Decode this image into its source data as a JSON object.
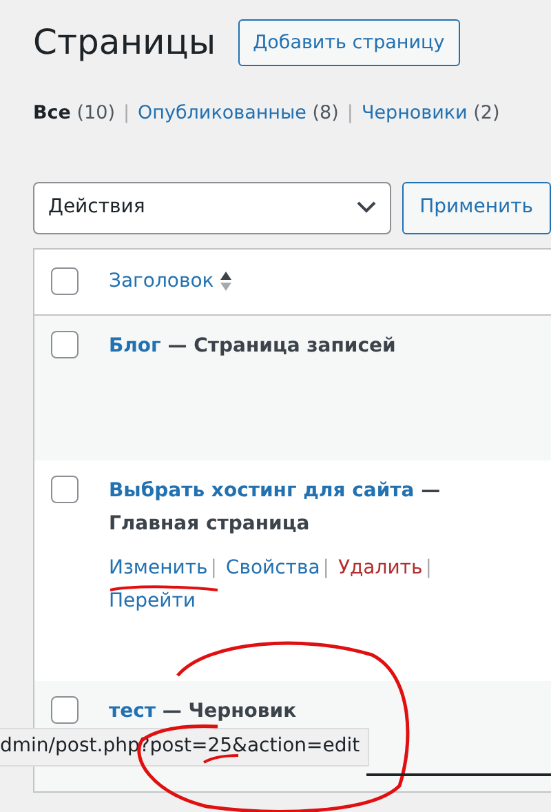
{
  "page_title": "Страницы",
  "add_button": "Добавить страницу",
  "filters": [
    {
      "label": "Все",
      "count": "(10)",
      "selected": true
    },
    {
      "separator": "|",
      "label": "Опубликованные",
      "count": "(8)",
      "selected": false
    },
    {
      "separator": "|",
      "label": "Черновики",
      "count": "(2)",
      "selected": false
    }
  ],
  "bulk_action": {
    "value": "Действия"
  },
  "apply_button": "Применить",
  "table": {
    "select_all_checked": false,
    "column_header": "Заголовок",
    "rows": [
      {
        "title": "Блог",
        "state": "— Страница записей",
        "checked": false,
        "row_actions": []
      },
      {
        "title": "Выбрать хостинг для сайта",
        "state": "— Главная страница",
        "checked": false,
        "row_actions": [
          {
            "label": "Изменить",
            "kind": "link",
            "separator": "|"
          },
          {
            "label": "Свойства",
            "kind": "link",
            "separator": "|"
          },
          {
            "label": "Удалить",
            "kind": "delete",
            "separator": "|"
          },
          {
            "label": "Перейти",
            "kind": "link"
          }
        ]
      },
      {
        "title": "тест",
        "state": "— Черновик",
        "checked": false,
        "row_actions": []
      }
    ]
  },
  "status_url": "dmin/post.php?post=25&action=edit"
}
